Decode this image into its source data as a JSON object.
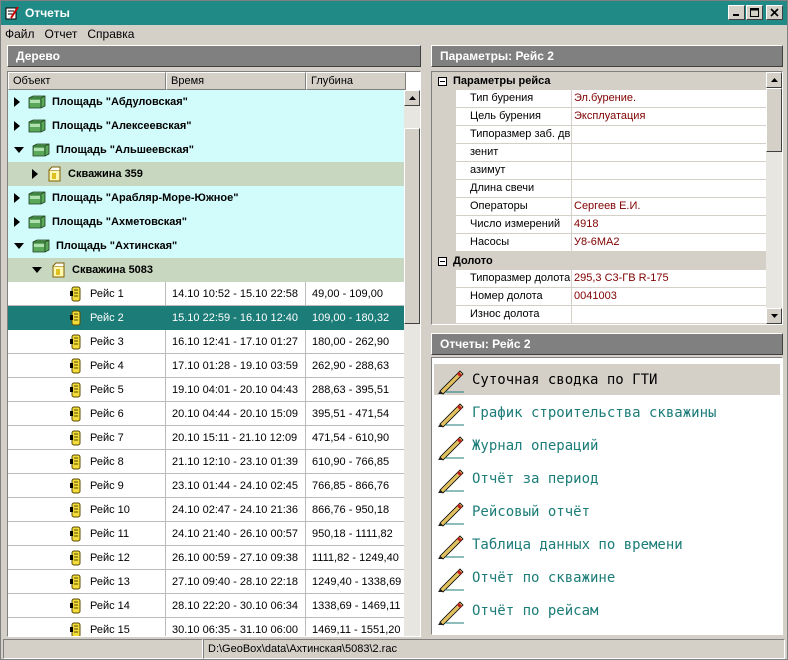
{
  "window": {
    "title": "Отчеты"
  },
  "menu": [
    {
      "label": "Файл"
    },
    {
      "label": "Отчет"
    },
    {
      "label": "Справка"
    }
  ],
  "tree": {
    "header": "Дерево",
    "columns": [
      "Объект",
      "Время",
      "Глубина"
    ],
    "nodes": [
      {
        "type": "area",
        "label": "Площадь \"Абдуловская\"",
        "expanded": false
      },
      {
        "type": "area",
        "label": "Площадь \"Алексеевская\"",
        "expanded": false
      },
      {
        "type": "area",
        "label": "Площадь \"Альшеевская\"",
        "expanded": true
      },
      {
        "type": "well",
        "label": "Скважина 359",
        "expanded": false
      },
      {
        "type": "area",
        "label": "Площадь \"Арабляр-Море-Южное\"",
        "expanded": false
      },
      {
        "type": "area",
        "label": "Площадь \"Ахметовская\"",
        "expanded": false
      },
      {
        "type": "area",
        "label": "Площадь \"Ахтинская\"",
        "expanded": true
      },
      {
        "type": "well",
        "label": "Скважина 5083",
        "expanded": true
      }
    ],
    "trips": [
      {
        "name": "Рейс 1",
        "time": "14.10 10:52 - 15.10 22:58",
        "depth": "49,00 - 109,00",
        "selected": false
      },
      {
        "name": "Рейс 2",
        "time": "15.10 22:59 - 16.10 12:40",
        "depth": "109,00 - 180,32",
        "selected": true
      },
      {
        "name": "Рейс 3",
        "time": "16.10 12:41 - 17.10 01:27",
        "depth": "180,00 - 262,90",
        "selected": false
      },
      {
        "name": "Рейс 4",
        "time": "17.10 01:28 - 19.10 03:59",
        "depth": "262,90 - 288,63",
        "selected": false
      },
      {
        "name": "Рейс 5",
        "time": "19.10 04:01 - 20.10 04:43",
        "depth": "288,63 - 395,51",
        "selected": false
      },
      {
        "name": "Рейс 6",
        "time": "20.10 04:44 - 20.10 15:09",
        "depth": "395,51 - 471,54",
        "selected": false
      },
      {
        "name": "Рейс 7",
        "time": "20.10 15:11 - 21.10 12:09",
        "depth": "471,54 - 610,90",
        "selected": false
      },
      {
        "name": "Рейс 8",
        "time": "21.10 12:10 - 23.10 01:39",
        "depth": "610,90 - 766,85",
        "selected": false
      },
      {
        "name": "Рейс 9",
        "time": "23.10 01:44 - 24.10 02:45",
        "depth": "766,85 - 866,76",
        "selected": false
      },
      {
        "name": "Рейс 10",
        "time": "24.10 02:47 - 24.10 21:36",
        "depth": "866,76 - 950,18",
        "selected": false
      },
      {
        "name": "Рейс 11",
        "time": "24.10 21:40 - 26.10 00:57",
        "depth": "950,18 - 1111,82",
        "selected": false
      },
      {
        "name": "Рейс 12",
        "time": "26.10 00:59 - 27.10 09:38",
        "depth": "1111,82 - 1249,40",
        "selected": false
      },
      {
        "name": "Рейс 13",
        "time": "27.10 09:40 - 28.10 22:18",
        "depth": "1249,40 - 1338,69",
        "selected": false
      },
      {
        "name": "Рейс 14",
        "time": "28.10 22:20 - 30.10 06:34",
        "depth": "1338,69 - 1469,11",
        "selected": false
      },
      {
        "name": "Рейс 15",
        "time": "30.10 06:35 - 31.10 06:00",
        "depth": "1469,11 - 1551,20",
        "selected": false
      }
    ]
  },
  "params": {
    "header": "Параметры: Рейс 2",
    "groups": [
      {
        "title": "Параметры рейса",
        "items": [
          {
            "label": "Тип бурения",
            "value": "Эл.бурение."
          },
          {
            "label": "Цель бурения",
            "value": "Эксплуатация"
          },
          {
            "label": "Типоразмер заб. дв",
            "value": ""
          },
          {
            "label": "зенит",
            "value": ""
          },
          {
            "label": "азимут",
            "value": ""
          },
          {
            "label": "Длина свечи",
            "value": ""
          },
          {
            "label": "Операторы",
            "value": "Сергеев Е.И."
          },
          {
            "label": "Число измерений",
            "value": "4918"
          },
          {
            "label": "Насосы",
            "value": "У8-6МА2"
          }
        ]
      },
      {
        "title": "Долото",
        "items": [
          {
            "label": "Типоразмер долота",
            "value": "295,3 С3-ГВ R-175"
          },
          {
            "label": "Номер долота",
            "value": "0041003"
          },
          {
            "label": "Износ долота",
            "value": ""
          }
        ]
      }
    ]
  },
  "reports": {
    "header": "Отчеты: Рейс 2",
    "items": [
      {
        "label": "Суточная сводка по ГТИ",
        "active": true
      },
      {
        "label": "График строительства скважины",
        "active": false
      },
      {
        "label": "Журнал операций",
        "active": false
      },
      {
        "label": "Отчёт за период",
        "active": false
      },
      {
        "label": "Рейсовый отчёт",
        "active": false
      },
      {
        "label": "Таблица данных по времени",
        "active": false
      },
      {
        "label": "Отчёт по скважине",
        "active": false
      },
      {
        "label": "Отчёт по рейсам",
        "active": false
      }
    ]
  },
  "status": {
    "path": "D:\\GeoBox\\data\\Ахтинская\\5083\\2.rac"
  },
  "colors": {
    "titlebar": "#1f8a86",
    "selection": "#1c7c78",
    "area_row": "#d2fbfb",
    "well_row": "#c8d8c0",
    "report_text": "#1c7c78",
    "param_value": "#800000"
  }
}
